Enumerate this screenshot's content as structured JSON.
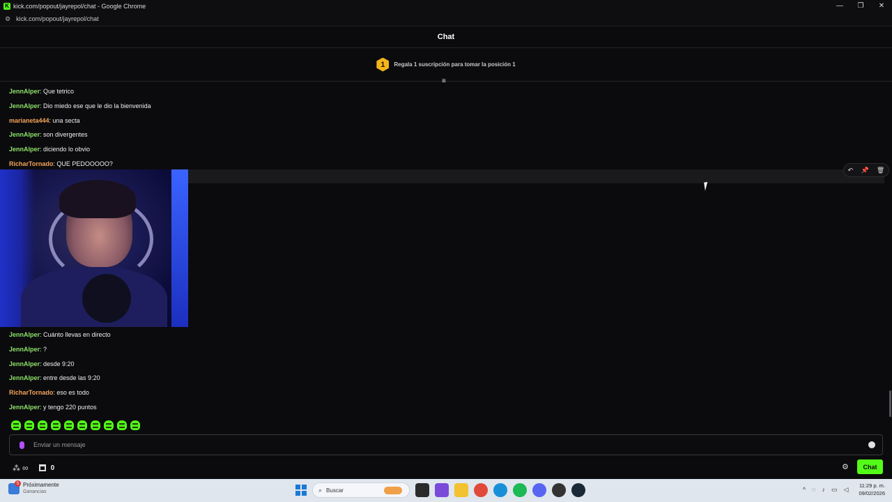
{
  "window": {
    "title": "kick.com/popout/jayrepol/chat - Google Chrome",
    "url": "kick.com/popout/jayrepol/chat",
    "controls": [
      "—",
      "❐",
      "✕"
    ]
  },
  "chat": {
    "header": "Chat",
    "promo": {
      "badge": "1",
      "text": "Regala 1 suscripción para tomar la posición 1"
    },
    "messages_top": [
      {
        "user": "JennAlper",
        "text": ": Que tetrico",
        "color": "green"
      },
      {
        "user": "JennAlper",
        "text": ": Dio miedo ese que le dio la bienvenida",
        "color": "green"
      },
      {
        "user": "marianeta444",
        "text": ": una secta",
        "color": "orange"
      },
      {
        "user": "JennAlper",
        "text": ": son divergentes",
        "color": "green"
      },
      {
        "user": "JennAlper",
        "text": ": diciendo lo obvio",
        "color": "green"
      },
      {
        "user": "RicharTornado",
        "text": ": QUE PEDOOOOO?",
        "color": "orange"
      }
    ],
    "messages_bottom": [
      {
        "user": "JennAlper",
        "text": ": Cuánto llevas en directo",
        "color": "green"
      },
      {
        "user": "JennAlper",
        "text": ": ?",
        "color": "green"
      },
      {
        "user": "JennAlper",
        "text": ": desde 9:20",
        "color": "green"
      },
      {
        "user": "JennAlper",
        "text": ": entre desde las 9:20",
        "color": "green"
      },
      {
        "user": "RicharTornado",
        "text": ": eso es todo",
        "color": "orange"
      },
      {
        "user": "JennAlper",
        "text": ": y tengo 220 puntos",
        "color": "green"
      }
    ],
    "input_placeholder": "Enviar un mensaje",
    "points_count": "0",
    "chat_button": "Chat",
    "colors": {
      "accent": "#53fc18",
      "user_green": "#8de36b",
      "user_orange": "#f5a45a"
    }
  },
  "taskbar": {
    "weather_badge": "5",
    "weather_title": "Próximamente",
    "weather_sub": "Ganancias",
    "search_placeholder": "Buscar",
    "time": "11:29 p. m.",
    "date": "09/02/2026"
  }
}
